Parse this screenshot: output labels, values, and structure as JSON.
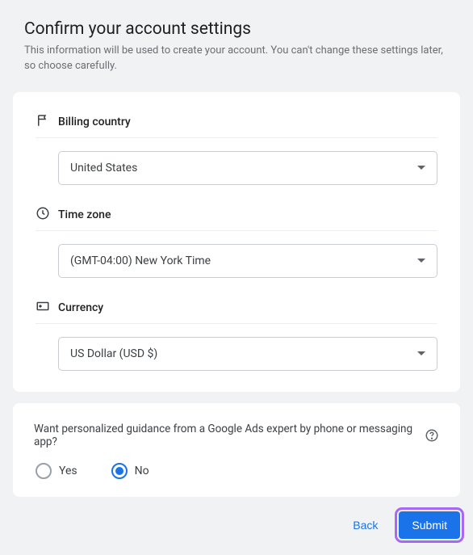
{
  "header": {
    "title": "Confirm your account settings",
    "subtitle": "This information will be used to create your account. You can't change these settings later, so choose carefully."
  },
  "fields": {
    "billing_country": {
      "label": "Billing country",
      "value": "United States"
    },
    "time_zone": {
      "label": "Time zone",
      "value": "(GMT-04:00) New York Time"
    },
    "currency": {
      "label": "Currency",
      "value": "US Dollar (USD $)"
    }
  },
  "guidance": {
    "question": "Want personalized guidance from a Google Ads expert by phone or messaging app?",
    "options": {
      "yes": "Yes",
      "no": "No"
    },
    "selected": "no"
  },
  "actions": {
    "back": "Back",
    "submit": "Submit"
  }
}
